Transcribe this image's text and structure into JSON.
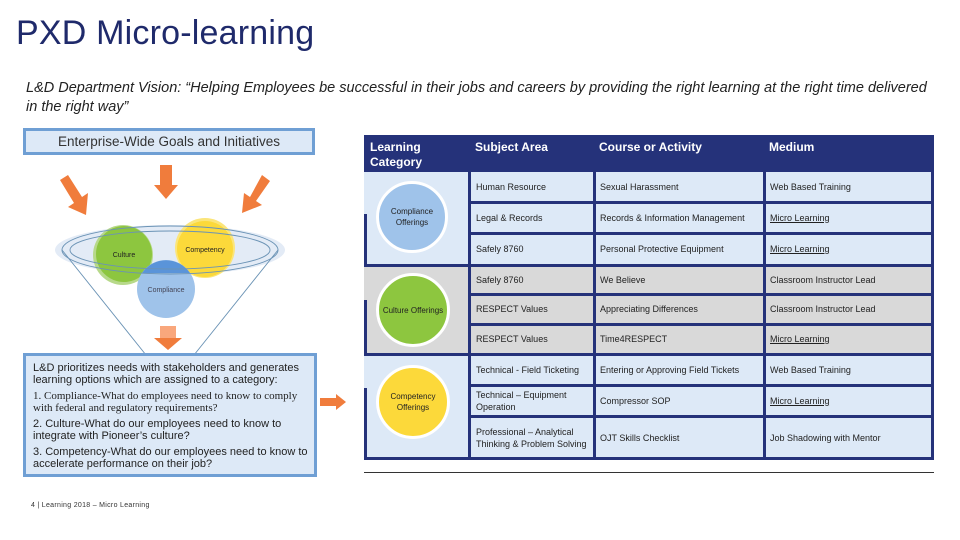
{
  "title": "PXD Micro-learning",
  "vision": "L&D Department Vision: “Helping Employees be successful in their jobs and careers by providing the right learning at the right time delivered in the right way”",
  "goals_box": "Enterprise-Wide Goals and Initiatives",
  "funnel": {
    "culture": "Culture",
    "competency": "Competency",
    "compliance": "Compliance"
  },
  "info_box": {
    "intro": "L&D prioritizes needs with stakeholders and generates learning options which are assigned to a category:",
    "item1": "1. Compliance-What do employees need to know to comply with federal and regulatory requirements?",
    "item2": "2. Culture-What do our employees need to know to integrate with Pioneer’s culture?",
    "item3": "3. Competency-What do our employees need to know to accelerate performance on their job?"
  },
  "footer": "4  |  Learning 2018 – Micro Learning",
  "colors": {
    "navy": "#25327a",
    "light_blue": "#dde9f7",
    "gray": "#d9d9d9",
    "compliance": "#9fc3ea",
    "culture": "#8dc63f",
    "competency": "#fcd93a",
    "arrow": "#f07c3c"
  },
  "table": {
    "headers": [
      "Learning Category",
      "Subject Area",
      "Course or Activity",
      "Medium"
    ],
    "groups": [
      {
        "category": "Compliance Offerings",
        "rows": [
          {
            "subject": "Human Resource",
            "course": "Sexual Harassment",
            "medium": "Web Based Training"
          },
          {
            "subject": "Legal & Records",
            "course": "Records & Information Management",
            "medium": "Micro Learning"
          },
          {
            "subject": "Safely 8760",
            "course": "Personal Protective Equipment",
            "medium": "Micro Learning"
          }
        ]
      },
      {
        "category": "Culture Offerings",
        "rows": [
          {
            "subject": "Safely 8760",
            "course": "We Believe",
            "medium": "Classroom Instructor Lead"
          },
          {
            "subject": "RESPECT Values",
            "course": "Appreciating Differences",
            "medium": "Classroom Instructor Lead"
          },
          {
            "subject": "RESPECT Values",
            "course": "Time4RESPECT",
            "medium": "Micro Learning"
          }
        ]
      },
      {
        "category": "Competency Offerings",
        "rows": [
          {
            "subject": "Technical - Field Ticketing",
            "course": "Entering or Approving Field Tickets",
            "medium": "Web Based Training"
          },
          {
            "subject": "Technical – Equipment Operation",
            "course": "Compressor SOP",
            "medium": "Micro Learning"
          },
          {
            "subject": "Professional – Analytical Thinking & Problem Solving",
            "course": "OJT Skills Checklist",
            "medium": "Job Shadowing with Mentor"
          }
        ]
      }
    ]
  }
}
